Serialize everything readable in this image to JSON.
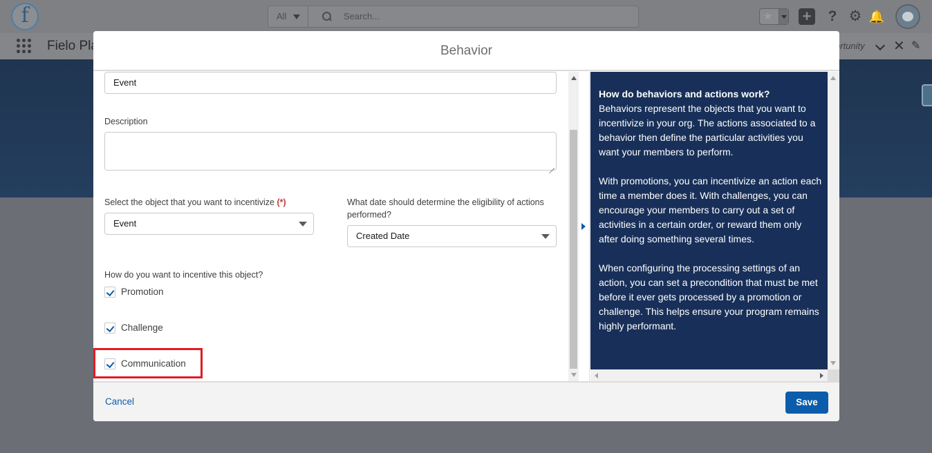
{
  "app": {
    "logo_letter": "f",
    "name": "Fielo Pla",
    "tab_fragment": "ortunity"
  },
  "search": {
    "scope": "All",
    "placeholder": "Search..."
  },
  "icons": {
    "star": "star-icon",
    "plus": "add-icon",
    "help": "help-icon",
    "settings": "gear-icon",
    "notifications": "bell-icon",
    "close": "close-icon",
    "edit": "pencil-icon"
  },
  "modal": {
    "title": "Behavior",
    "form": {
      "name_value": "Event",
      "description_label": "Description",
      "description_value": "",
      "object_label": "Select the object that you want to incentivize",
      "required_marker": "(*)",
      "object_value": "Event",
      "date_label_line1": "What date should determine the eligibility of actions",
      "date_label_line2": "performed?",
      "date_value": "Created Date",
      "incentive_label": "How do you want to incentive this object?",
      "options": [
        {
          "label": "Promotion",
          "checked": true
        },
        {
          "label": "Challenge",
          "checked": true
        },
        {
          "label": "Communication",
          "checked": true
        }
      ]
    },
    "help": {
      "title": "How do behaviors and actions work?",
      "paragraph1": "Behaviors represent the objects that you want to incentivize in your org. The actions associated to a behavior then define the particular activities you want your members to perform.",
      "paragraph2": "With promotions, you can incentivize an action each time a member does it. With challenges, you can encourage your members to carry out a set of activities in a certain order, or reward them only after doing something several times.",
      "paragraph3": "When configuring the processing settings of an action, you can set a precondition that must be met before it ever gets processed by a promotion or challenge. This helps ensure your program remains highly performant."
    },
    "footer": {
      "cancel_label": "Cancel",
      "save_label": "Save"
    }
  },
  "colors": {
    "brand": "#0b5cab",
    "help_panel": "#183059",
    "highlight": "#e21b23",
    "required": "#c23934"
  }
}
